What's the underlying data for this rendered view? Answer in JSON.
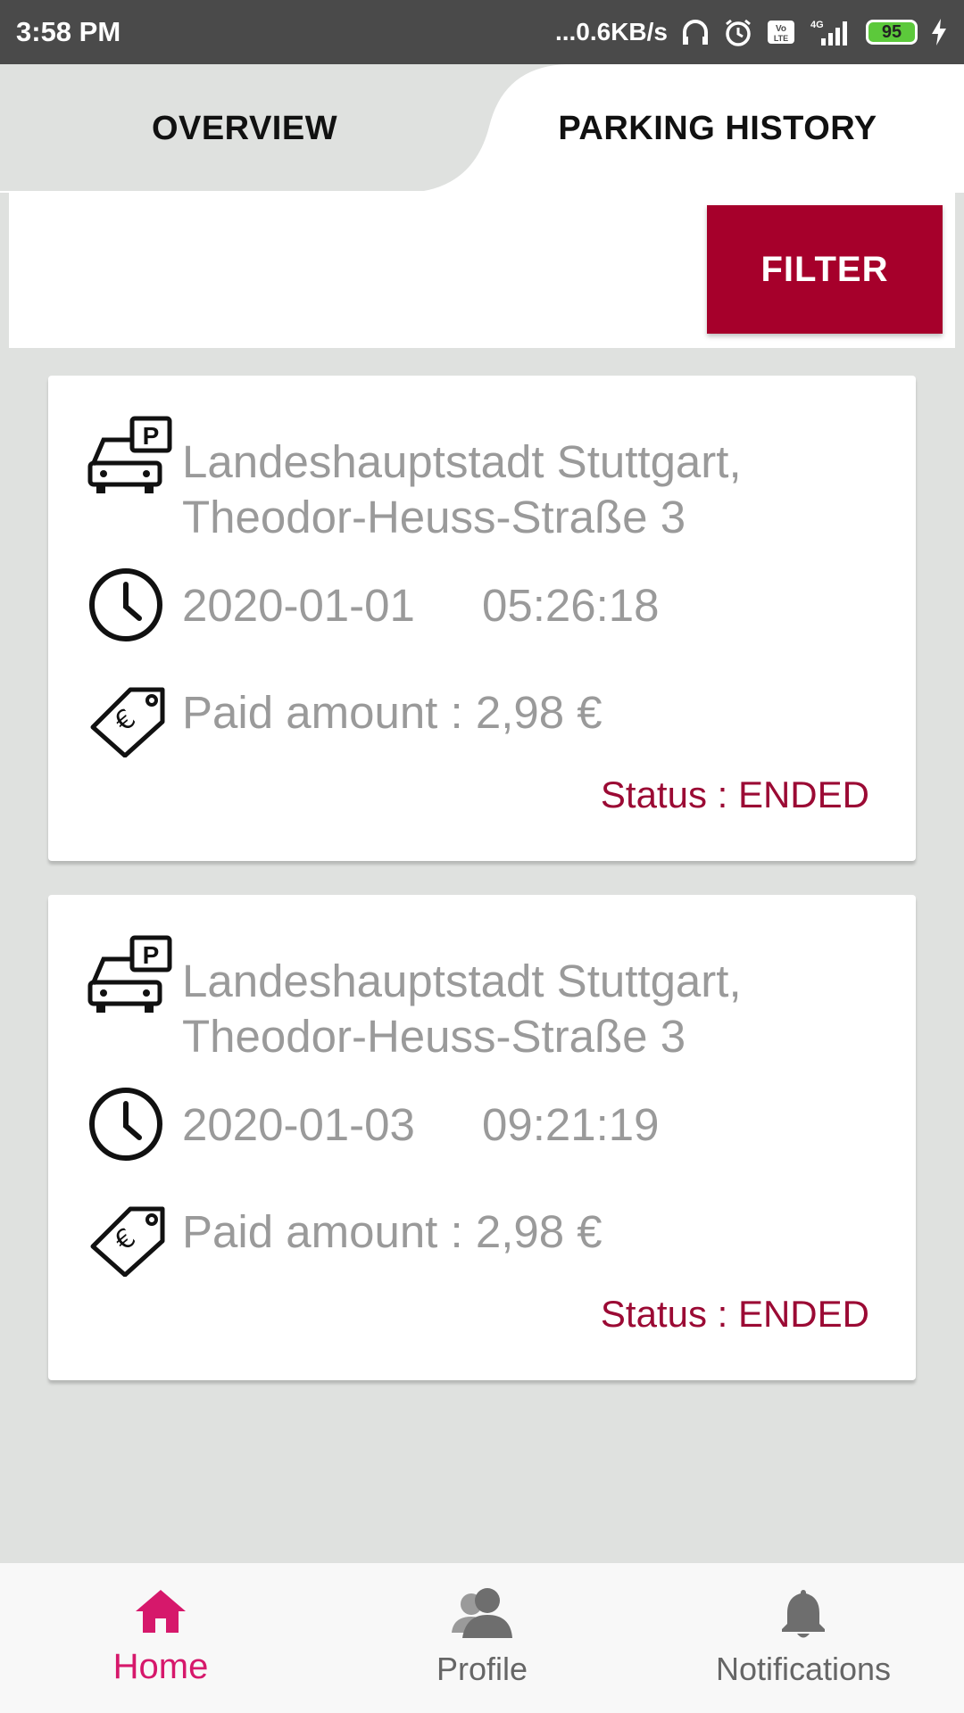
{
  "status_bar": {
    "time": "3:58 PM",
    "network_speed": "...0.6KB/s",
    "battery": "95"
  },
  "tabs": [
    {
      "label": "OVERVIEW",
      "active": false
    },
    {
      "label": "PARKING HISTORY",
      "active": true
    }
  ],
  "filter": {
    "label": "FILTER"
  },
  "records": [
    {
      "location": "Landeshauptstadt Stuttgart, Theodor-Heuss-Straße 3",
      "date": "2020-01-01",
      "time": "05:26:18",
      "amount": "Paid amount : 2,98 €",
      "status": "Status : ENDED"
    },
    {
      "location": "Landeshauptstadt Stuttgart, Theodor-Heuss-Straße 3",
      "date": "2020-01-03",
      "time": "09:21:19",
      "amount": "Paid amount : 2,98 €",
      "status": "Status : ENDED"
    }
  ],
  "bottom_nav": [
    {
      "label": "Home",
      "icon": "home-icon",
      "active": true
    },
    {
      "label": "Profile",
      "icon": "profile-icon",
      "active": false
    },
    {
      "label": "Notifications",
      "icon": "bell-icon",
      "active": false
    }
  ],
  "colors": {
    "accent_red": "#a6002b",
    "status_red": "#9b0a34",
    "nav_active": "#d6186b",
    "background": "#dfe1df"
  }
}
